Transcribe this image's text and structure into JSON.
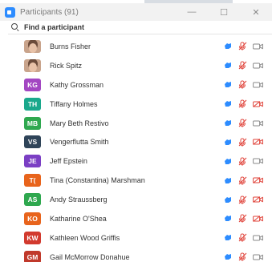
{
  "window": {
    "title": "Participants (91)",
    "minimize_glyph": "—",
    "maximize_glyph": "☐",
    "close_glyph": "✕"
  },
  "search": {
    "placeholder": "Find a participant"
  },
  "colors": {
    "hand": "#2d8cff",
    "muted": "#e0433a",
    "camera": "#8a8a8a",
    "camera_off": "#e0433a"
  },
  "participants": [
    {
      "name": "Burns Fisher",
      "initials": "",
      "avatar_color": "",
      "photo": true,
      "camera_off": false
    },
    {
      "name": "Rick Spitz",
      "initials": "",
      "avatar_color": "",
      "photo": true,
      "camera_off": false
    },
    {
      "name": "Kathy Grossman",
      "initials": "KG",
      "avatar_color": "#a347c2",
      "photo": false,
      "camera_off": false
    },
    {
      "name": "Tiffany Holmes",
      "initials": "TH",
      "avatar_color": "#1aa88c",
      "photo": false,
      "camera_off": true
    },
    {
      "name": "Mary Beth Restivo",
      "initials": "MB",
      "avatar_color": "#2fa84f",
      "photo": false,
      "camera_off": false
    },
    {
      "name": "Vengerflutta Smith",
      "initials": "VS",
      "avatar_color": "#2f4459",
      "photo": false,
      "camera_off": true
    },
    {
      "name": "Jeff Epstein",
      "initials": "JE",
      "avatar_color": "#7b3fc4",
      "photo": false,
      "camera_off": false
    },
    {
      "name": "Tina (Constantina) Marshman",
      "initials": "T(",
      "avatar_color": "#e8641c",
      "photo": false,
      "camera_off": true
    },
    {
      "name": "Andy Straussberg",
      "initials": "AS",
      "avatar_color": "#2fa84f",
      "photo": false,
      "camera_off": true
    },
    {
      "name": "Katharine O'Shea",
      "initials": "KO",
      "avatar_color": "#e8641c",
      "photo": false,
      "camera_off": true
    },
    {
      "name": "Kathleen Wood Griffis",
      "initials": "KW",
      "avatar_color": "#d23a2e",
      "photo": false,
      "camera_off": false
    },
    {
      "name": "Gail McMorrow Donahue",
      "initials": "GM",
      "avatar_color": "#c0392b",
      "photo": false,
      "camera_off": false
    }
  ]
}
